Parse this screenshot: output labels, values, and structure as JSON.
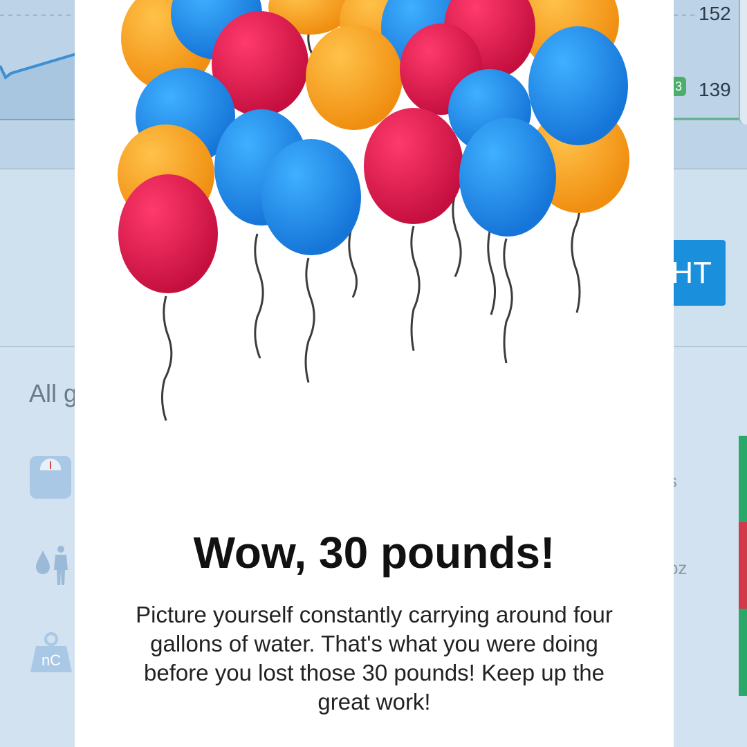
{
  "background": {
    "chart_values": [
      "152",
      "139"
    ],
    "badge_text": "3",
    "button_label": "HT",
    "list_label": "All g",
    "side_texts": [
      "s",
      "oz"
    ],
    "icons": [
      "scale-icon",
      "water-body-icon",
      "weight-nc-icon"
    ],
    "nc_label": "nC",
    "strip_colors": [
      "#2aa86a",
      "#d2394a",
      "#2aa86a"
    ]
  },
  "modal": {
    "title": "Wow, 30 pounds!",
    "message": "Picture yourself constantly carrying around four gallons of water. That's what you were doing before you lost those 30 pounds! Keep up the great work!",
    "illustration": "balloons-illustration",
    "balloon_colors": {
      "orange": "#f7a21d",
      "blue": "#1c8fe8",
      "red": "#e5194f"
    }
  }
}
